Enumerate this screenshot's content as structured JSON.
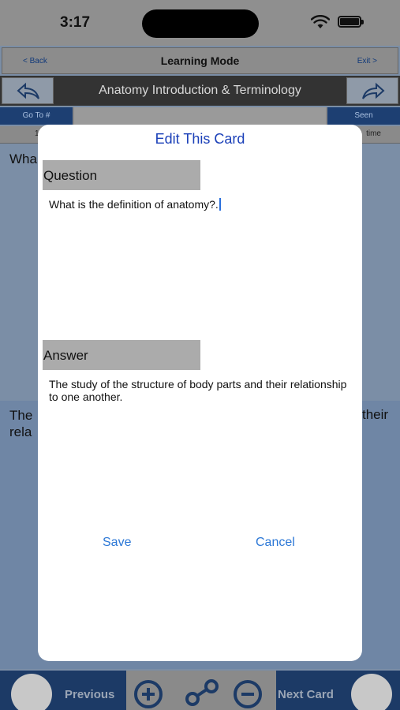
{
  "status_bar": {
    "time": "3:17"
  },
  "nav": {
    "back_label": "< Back",
    "title": "Learning Mode",
    "exit_label": "Exit >"
  },
  "deck": {
    "title": "Anatomy Introduction & Terminology"
  },
  "toolbar": {
    "goto_label": "Go To #",
    "seen_label": "Seen"
  },
  "stats": {
    "left": "1",
    "right": "time"
  },
  "card": {
    "question_preview": "Wha",
    "answer_preview_line1": "The",
    "answer_preview_line2": "rela",
    "answer_preview_tail": "their"
  },
  "bottom_bar": {
    "previous_label": "Previous",
    "next_label": "Next Card"
  },
  "modal": {
    "title": "Edit This Card",
    "question_header": "Question",
    "question_text": "What is the definition of anatomy?.",
    "answer_header": "Answer",
    "answer_text": "The study of the structure of body parts and their relationship to one another.",
    "save_label": "Save",
    "cancel_label": "Cancel"
  },
  "colors": {
    "accent": "#2b77d6",
    "title_blue": "#1a3fb8",
    "nav_dark": "#1c3a66"
  }
}
